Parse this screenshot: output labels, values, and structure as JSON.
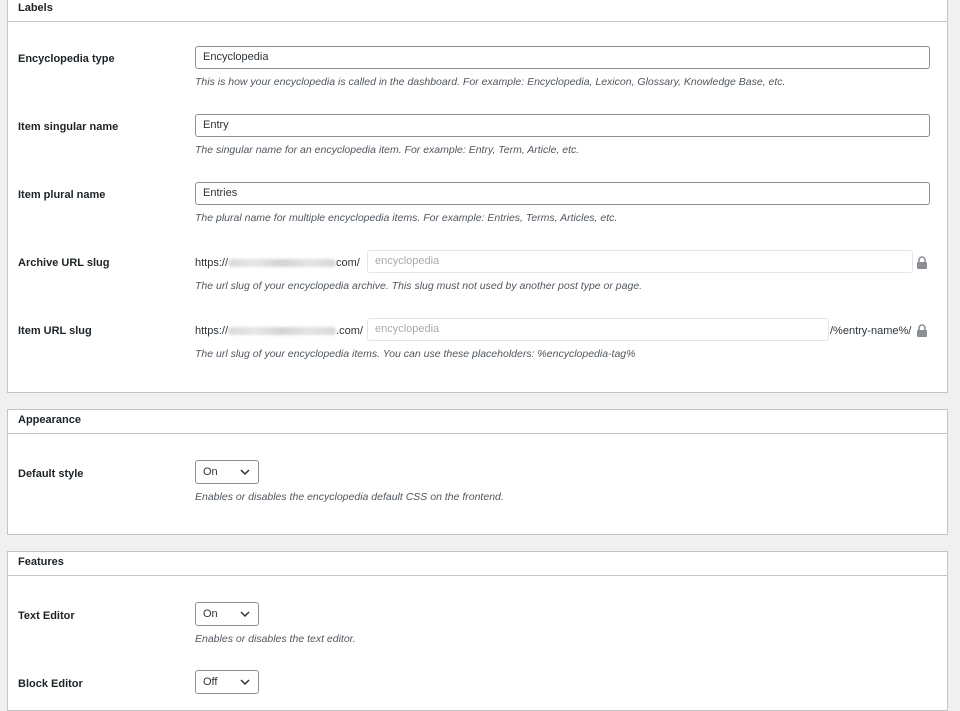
{
  "labels_section": {
    "title": "Labels",
    "encyclopedia_type": {
      "label": "Encyclopedia type",
      "value": "Encyclopedia",
      "description": "This is how your encyclopedia is called in the dashboard. For example: Encyclopedia, Lexicon, Glossary, Knowledge Base, etc."
    },
    "item_singular": {
      "label": "Item singular name",
      "value": "Entry",
      "description": "The singular name for an encyclopedia item. For example: Entry, Term, Article, etc."
    },
    "item_plural": {
      "label": "Item plural name",
      "value": "Entries",
      "description": "The plural name for multiple encyclopedia items. For example: Entries, Terms, Articles, etc."
    },
    "archive_slug": {
      "label": "Archive URL slug",
      "prefix_start": "https://",
      "prefix_end": "com/",
      "placeholder": "encyclopedia",
      "description": "The url slug of your encyclopedia archive. This slug must not used by another post type or page."
    },
    "item_slug": {
      "label": "Item URL slug",
      "prefix_start": "https://",
      "prefix_end": ".com/",
      "placeholder": "encyclopedia",
      "suffix": "/%entry-name%/",
      "description": "The url slug of your encyclopedia items. You can use these placeholders: %encyclopedia-tag%"
    }
  },
  "appearance_section": {
    "title": "Appearance",
    "default_style": {
      "label": "Default style",
      "value": "On",
      "description": "Enables or disables the encyclopedia default CSS on the frontend."
    }
  },
  "features_section": {
    "title": "Features",
    "text_editor": {
      "label": "Text Editor",
      "value": "On",
      "description": "Enables or disables the text editor."
    },
    "block_editor": {
      "label": "Block Editor",
      "value": "Off"
    }
  },
  "icons": {
    "lock": "lock-icon",
    "chevron": "chevron-down-icon"
  }
}
